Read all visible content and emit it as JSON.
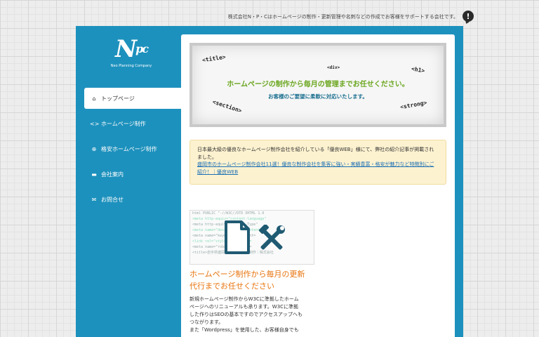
{
  "header": {
    "tagline": "株式会社N・P・Cはホームページの制作・更新管理や名刺などの作成でお客様をサポートする会社です。",
    "alert_icon": "!"
  },
  "logo": {
    "mark_main": "N",
    "mark_small": "pc",
    "company": "Neo Planning Company"
  },
  "nav": {
    "items": [
      {
        "label": "トップページ",
        "icon": "home-icon",
        "glyph": "⌂"
      },
      {
        "label": "ホームページ制作",
        "icon": "code-icon",
        "glyph": "<>"
      },
      {
        "label": "格安ホームページ制作",
        "icon": "globe-icon",
        "glyph": "⊕"
      },
      {
        "label": "会社案内",
        "icon": "chat-icon",
        "glyph": "▬"
      },
      {
        "label": "お問合せ",
        "icon": "mail-icon",
        "glyph": "✉"
      }
    ]
  },
  "hero": {
    "tags": {
      "title": "<title>",
      "div": "<div>",
      "h1": "<h1>",
      "section": "<section>",
      "strong": "<strong>"
    },
    "title": "ホームページの制作から毎月の管理までお任せください。",
    "subtitle": "お客様のご要望に柔軟に対応いたします。"
  },
  "notice": {
    "text": "日本最大級の優良なホームページ制作会社を紹介している「優良WEB」様にて、弊社の紹介記事が掲載されました。",
    "link": "盛岡市のホームページ制作会社11選！優良な制作会社を集客に強い・実績豊富・格安が魅力など特徴別にご紹介！｜優良WEB"
  },
  "feature": {
    "code_lines": [
      "html PUBLIC \"-//W3C//DTD XHTML 1.0",
      "<meta http-equiv=\"content-language\"",
      "<meta http-equiv=\"Content-Type\"",
      "<meta name=\"description\" content=",
      "<meta name=\"keywords\" content=",
      "<link rel=\"stylesheet\" href=",
      "<meta name=\"robots\" content=",
      "<title>岩手県盛岡市ホームページ制作｜株式会社"
    ],
    "title_line1": "ホームページ制作から毎月の更新",
    "title_line2": "代行までお任せください",
    "body": [
      "新規ホームページ制作からW3Cに準拠したホーム",
      "ページへのリニューアルも承ります。W3Cに準拠",
      "した作りはSEOの基本ですのでアクセスアップへも",
      "つながります。",
      "また「Wordpress」を使用した、お客様自身でも"
    ]
  },
  "colors": {
    "brand_blue": "#1d91bd",
    "accent_orange": "#e8730c",
    "hero_green": "#6aa61e",
    "notice_bg": "#fdf2d0"
  }
}
